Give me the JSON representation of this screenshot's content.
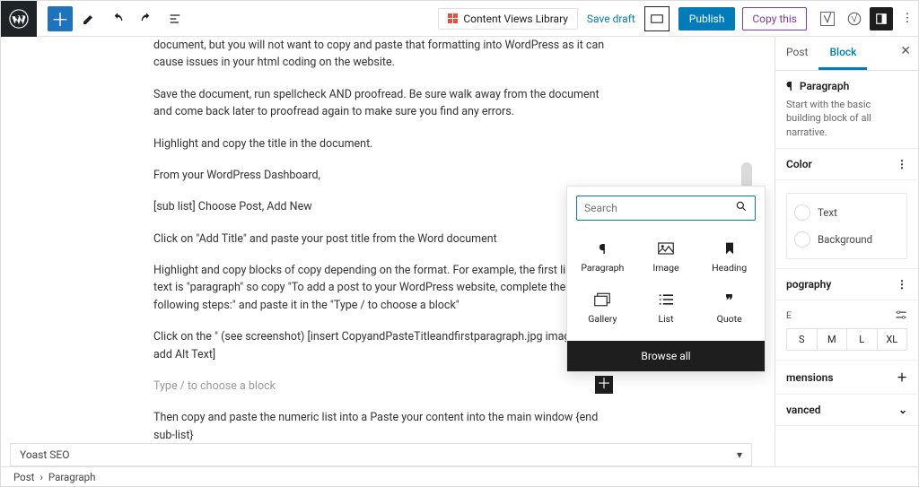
{
  "topbar": {
    "content_views": "Content Views Library",
    "save_draft": "Save draft",
    "publish": "Publish",
    "copy_this": "Copy this"
  },
  "editor": {
    "para1": "document, but you will not want to copy and paste that formatting into WordPress as it can cause issues in your html coding on the website.",
    "para2": "Save the document, run spellcheck AND proofread. Be sure walk away from the document and come back later to proofread again to make sure you find any errors.",
    "para3": "Highlight and copy the title in the document.",
    "para4": "From your WordPress Dashboard,",
    "para5": "[sub list] Choose Post, Add New",
    "para6": "Click on \"Add Title\" and paste your post title from the Word document",
    "para7": "Highlight and copy blocks of copy depending on the format. For example, the first line of text is \"paragraph\" so copy \"To add a post to your WordPress website, complete the following steps:\" and paste it in the \"Type / to choose a block\"",
    "para8": "Click on the \" (see screenshot) [insert CopyandPasteTitleandfirstparagraph.jpg image and add Alt Text]",
    "placeholder": "Type / to choose a block",
    "para9": "Then copy and paste the numeric list into a Paste your content into the main window {end sub-list}"
  },
  "inserter": {
    "search_placeholder": "Search",
    "items": [
      "Paragraph",
      "Image",
      "Heading",
      "Gallery",
      "List",
      "Quote"
    ],
    "browse": "Browse all"
  },
  "sidebar": {
    "tabs": {
      "post": "Post",
      "block": "Block"
    },
    "block_name": "Paragraph",
    "block_desc": "Start with the basic building block of all narrative.",
    "panels": {
      "color": "Color",
      "typography": "pography",
      "size_label": "E",
      "dimensions": "mensions",
      "advanced": "vanced"
    },
    "color_opts": {
      "text": "Text",
      "background": "Background"
    },
    "sizes": [
      "S",
      "M",
      "L",
      "XL"
    ]
  },
  "yoast": "Yoast SEO",
  "breadcrumb": {
    "post": "Post",
    "block": "Paragraph"
  }
}
